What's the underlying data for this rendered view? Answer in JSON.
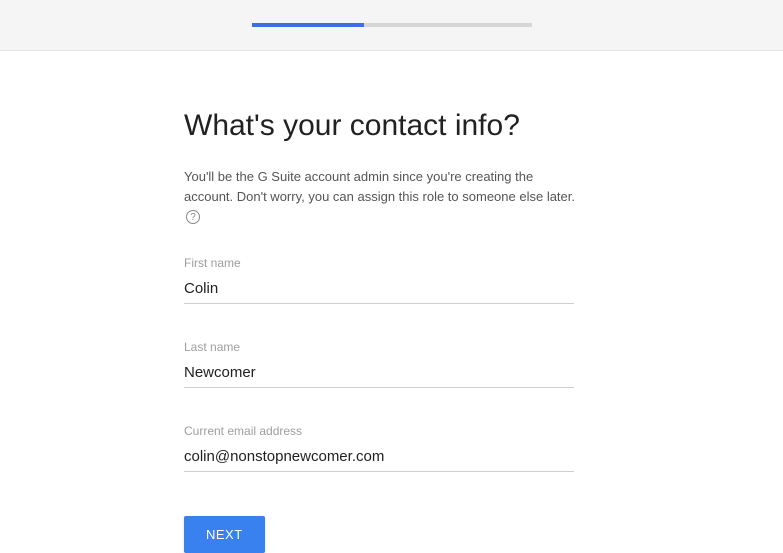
{
  "progress": {
    "percent": 40
  },
  "heading": "What's your contact info?",
  "description": "You'll be the G Suite account admin since you're creating the account. Don't worry, you can assign this role to someone else later.",
  "help_glyph": "?",
  "fields": {
    "first_name": {
      "label": "First name",
      "value": "Colin"
    },
    "last_name": {
      "label": "Last name",
      "value": "Newcomer"
    },
    "email": {
      "label": "Current email address",
      "value": "colin@nonstopnewcomer.com"
    }
  },
  "buttons": {
    "next": "NEXT"
  }
}
